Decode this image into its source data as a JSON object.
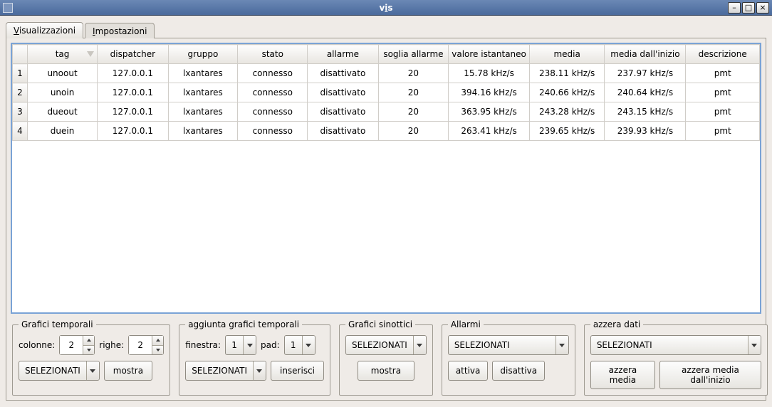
{
  "window": {
    "title": "vis"
  },
  "tabs": {
    "visual": "Visualizzazioni",
    "impost": "Impostazioni"
  },
  "table": {
    "headers": {
      "tag": "tag",
      "dispatcher": "dispatcher",
      "gruppo": "gruppo",
      "stato": "stato",
      "allarme": "allarme",
      "soglia": "soglia allarme",
      "valore": "valore istantaneo",
      "media": "media",
      "media_inizio": "media dall'inizio",
      "descrizione": "descrizione"
    },
    "rows": [
      {
        "n": "1",
        "tag": "unoout",
        "dispatcher": "127.0.0.1",
        "gruppo": "lxantares",
        "stato": "connesso",
        "allarme": "disattivato",
        "soglia": "20",
        "valore": "15.78 kHz/s",
        "media": "238.11 kHz/s",
        "media_inizio": "237.97 kHz/s",
        "descrizione": "pmt"
      },
      {
        "n": "2",
        "tag": "unoin",
        "dispatcher": "127.0.0.1",
        "gruppo": "lxantares",
        "stato": "connesso",
        "allarme": "disattivato",
        "soglia": "20",
        "valore": "394.16 kHz/s",
        "media": "240.66 kHz/s",
        "media_inizio": "240.64 kHz/s",
        "descrizione": "pmt"
      },
      {
        "n": "3",
        "tag": "dueout",
        "dispatcher": "127.0.0.1",
        "gruppo": "lxantares",
        "stato": "connesso",
        "allarme": "disattivato",
        "soglia": "20",
        "valore": "363.95 kHz/s",
        "media": "243.28 kHz/s",
        "media_inizio": "243.15 kHz/s",
        "descrizione": "pmt"
      },
      {
        "n": "4",
        "tag": "duein",
        "dispatcher": "127.0.0.1",
        "gruppo": "lxantares",
        "stato": "connesso",
        "allarme": "disattivato",
        "soglia": "20",
        "valore": "263.41 kHz/s",
        "media": "239.65 kHz/s",
        "media_inizio": "239.93 kHz/s",
        "descrizione": "pmt"
      }
    ]
  },
  "panels": {
    "grafici_temporali": {
      "legend": "Grafici temporali",
      "colonne_label": "colonne:",
      "colonne_value": "2",
      "righe_label": "righe:",
      "righe_value": "2",
      "select_label": "SELEZIONATI",
      "mostra": "mostra"
    },
    "aggiunta": {
      "legend": "aggiunta grafici temporali",
      "finestra_label": "finestra:",
      "finestra_value": "1",
      "pad_label": "pad:",
      "pad_value": "1",
      "select_label": "SELEZIONATI",
      "inserisci": "inserisci"
    },
    "sinottici": {
      "legend": "Grafici sinottici",
      "select_label": "SELEZIONATI",
      "mostra": "mostra"
    },
    "allarmi": {
      "legend": "Allarmi",
      "select_label": "SELEZIONATI",
      "attiva": "attiva",
      "disattiva": "disattiva"
    },
    "azzera": {
      "legend": "azzera dati",
      "select_label": "SELEZIONATI",
      "azzera_media": "azzera media",
      "azzera_media_inizio": "azzera media dall'inizio"
    }
  }
}
